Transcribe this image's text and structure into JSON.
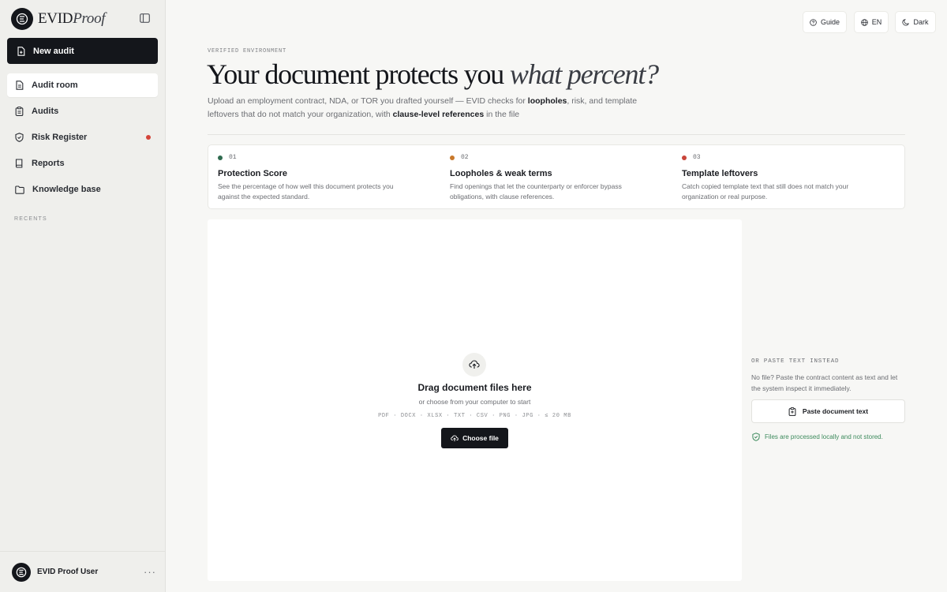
{
  "brand": {
    "name_a": "EVID",
    "name_b": "Proof",
    "logo_letter": "E"
  },
  "sidebar": {
    "new_audit_label": "New audit",
    "items": [
      {
        "label": "Audit room",
        "icon": "document-icon",
        "active": true
      },
      {
        "label": "Audits",
        "icon": "clipboard-icon"
      },
      {
        "label": "Risk Register",
        "icon": "shield-icon",
        "badge": true
      },
      {
        "label": "Reports",
        "icon": "book-icon"
      },
      {
        "label": "Knowledge base",
        "icon": "folder-icon"
      }
    ],
    "recents_label": "RECENTS",
    "user_name": "EVID Proof User",
    "more_label": "···"
  },
  "topbar": {
    "guide_label": "Guide",
    "lang_label": "EN",
    "theme_label": "Dark"
  },
  "hero": {
    "kicker": "VERIFIED ENVIRONMENT",
    "headline_main": "Your document protects you ",
    "headline_emphasis": "what percent?",
    "lead_1": "Upload an employment contract, NDA, or TOR you drafted yourself — EVID checks for ",
    "lead_bold_1": "loopholes",
    "lead_2": ", risk, and template leftovers that do not match your organization, with ",
    "lead_bold_2": "clause-level references",
    "lead_3": " in the file"
  },
  "features": [
    {
      "num": "01",
      "title": "Protection Score",
      "desc": "See the percentage of how well this document protects you against the expected standard.",
      "color": "#2f6b4f"
    },
    {
      "num": "02",
      "title": "Loopholes & weak terms",
      "desc": "Find openings that let the counterparty or enforcer bypass obligations, with clause references.",
      "color": "#c8782a"
    },
    {
      "num": "03",
      "title": "Template leftovers",
      "desc": "Catch copied template text that still does not match your organization or real purpose.",
      "color": "#c9453a"
    }
  ],
  "dropzone": {
    "title": "Drag document files here",
    "subtitle": "or choose from your computer to start",
    "formats": "PDF · DOCX · XLSX · TXT · CSV · PNG · JPG · ≤ 20 MB",
    "button_label": "Choose file"
  },
  "paste": {
    "kicker": "OR PASTE TEXT INSTEAD",
    "desc": "No file? Paste the contract content as text and let the system inspect it immediately.",
    "button_label": "Paste document text",
    "note": "Files are processed locally and not stored."
  },
  "colors": {
    "accent_dark": "#14161b",
    "success": "#3c8a5c",
    "alert": "#d4453a"
  }
}
